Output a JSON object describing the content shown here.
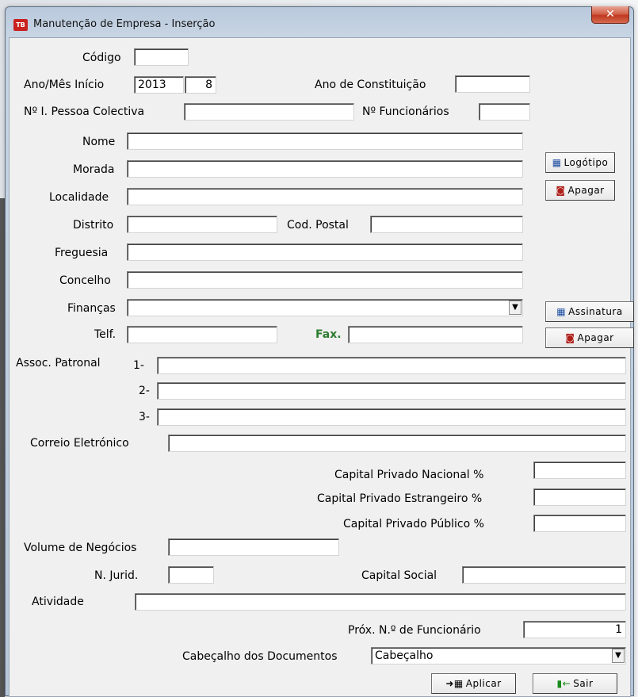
{
  "window": {
    "title": "Manutenção de Empresa - Inserção",
    "icon_text": "TB",
    "close_glyph": "✕"
  },
  "labels": {
    "codigo": "Código",
    "ano_mes_inicio": "Ano/Mês Início",
    "ano_constituicao": "Ano de Constituição",
    "nipc": "Nº I. Pessoa Colectiva",
    "num_funcionarios": "Nº Funcionários",
    "nome": "Nome",
    "morada": "Morada",
    "localidade": "Localidade",
    "distrito": "Distrito",
    "cod_postal": "Cod. Postal",
    "freguesia": "Freguesia",
    "concelho": "Concelho",
    "financas": "Finanças",
    "telf": "Telf.",
    "fax": "Fax.",
    "assoc_patronal": "Assoc. Patronal",
    "assoc_1": "1-",
    "assoc_2": "2-",
    "assoc_3": "3-",
    "correio": "Correio Eletrónico",
    "cap_nacional": "Capital Privado Nacional %",
    "cap_estrangeiro": "Capital Privado Estrangeiro %",
    "cap_publico": "Capital Privado Público %",
    "volume_negocios": "Volume de Negócios",
    "n_jurid": "N. Jurid.",
    "capital_social": "Capital Social",
    "atividade": "Atividade",
    "prox_funcionario": "Próx. N.º de Funcionário",
    "cabecalho": "Cabeçalho dos Documentos"
  },
  "values": {
    "codigo": "",
    "ano": "2013",
    "mes": "8",
    "ano_constituicao": "",
    "nipc": "",
    "num_funcionarios": "",
    "nome": "",
    "morada": "",
    "localidade": "",
    "distrito": "",
    "cod_postal": "",
    "freguesia": "",
    "concelho": "",
    "financas": "",
    "telf": "",
    "fax": "",
    "assoc_1": "",
    "assoc_2": "",
    "assoc_3": "",
    "correio": "",
    "cap_nacional": "",
    "cap_estrangeiro": "",
    "cap_publico": "",
    "volume_negocios": "",
    "n_jurid": "",
    "capital_social": "",
    "atividade": "",
    "prox_funcionario": "1",
    "cabecalho": "Cabeçalho"
  },
  "buttons": {
    "logotipo": "Logótipo",
    "apagar_logo": "Apagar",
    "assinatura": "Assinatura",
    "apagar_assinatura": "Apagar",
    "aplicar": "Aplicar",
    "sair": "Sair"
  },
  "icons": {
    "film": "film-icon",
    "camera": "camera-delete-icon",
    "apply": "apply-icon",
    "exit": "exit-door-icon",
    "dropdown": "▼"
  }
}
